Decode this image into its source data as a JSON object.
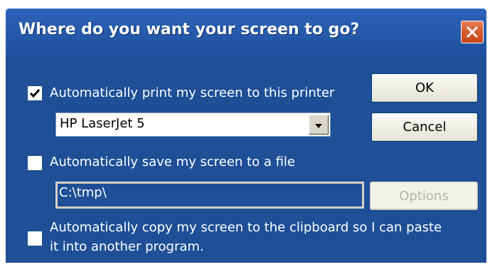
{
  "window": {
    "title": "Where do you want your screen to go?"
  },
  "options": {
    "print": {
      "checked": true,
      "label": "Automatically print my screen to this printer",
      "printer": "HP LaserJet 5"
    },
    "save": {
      "checked": false,
      "label": "Automatically save my screen to a file",
      "path": "C:\\tmp\\",
      "options_button": "Options"
    },
    "clipboard": {
      "checked": false,
      "label_line1": "Automatically copy my screen to the clipboard so I can paste",
      "label_line2": "it into another program."
    }
  },
  "buttons": {
    "ok": "OK",
    "cancel": "Cancel"
  },
  "icons": {
    "close": "close-icon",
    "check": "checkmark-icon",
    "dropdown": "chevron-down-icon"
  },
  "colors": {
    "dialog_bg": "#1e4f97",
    "title_text": "#ffffff",
    "close_button": "#d55a2c"
  }
}
